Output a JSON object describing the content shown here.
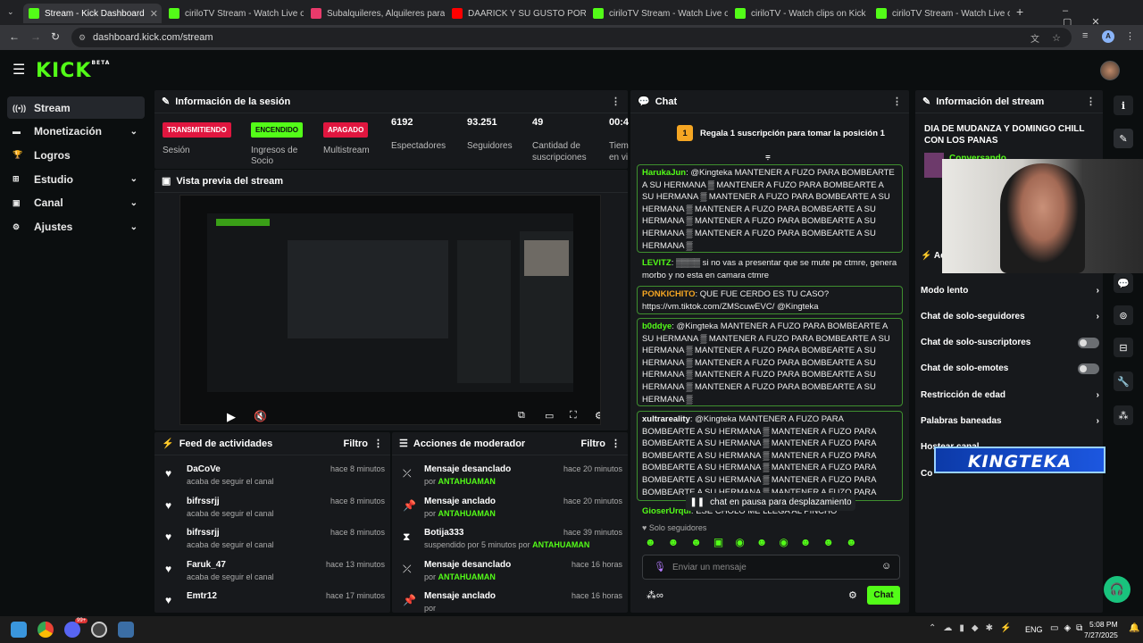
{
  "browser": {
    "tabs": [
      {
        "label": "Stream - Kick Dashboard",
        "color": "#53fc18",
        "active": true
      },
      {
        "label": "ciriloTV Stream - Watch Live on",
        "color": "#53fc18"
      },
      {
        "label": "Subalquileres, Alquileres para e",
        "color": "#e83a6b"
      },
      {
        "label": "DAARICK Y SU GUSTO POR LAS",
        "color": "#ff0000"
      },
      {
        "label": "ciriloTV Stream - Watch Live on",
        "color": "#53fc18"
      },
      {
        "label": "ciriloTV - Watch clips on Kick",
        "color": "#53fc18"
      },
      {
        "label": "ciriloTV Stream - Watch Live on",
        "color": "#53fc18"
      }
    ],
    "new_tab": "+",
    "url": "dashboard.kick.com/stream",
    "profile": "A"
  },
  "header": {
    "logo": "KICK",
    "logo_sup": "BETA"
  },
  "sidebar": {
    "items": [
      {
        "label": "Stream",
        "icon": "broadcast-icon",
        "glyph": "((•))",
        "chev": ""
      },
      {
        "label": "Monetización",
        "icon": "money-icon",
        "glyph": "▬",
        "chev": "⌄"
      },
      {
        "label": "Logros",
        "icon": "trophy-icon",
        "glyph": "🏆",
        "chev": ""
      },
      {
        "label": "Estudio",
        "icon": "studio-icon",
        "glyph": "⊞",
        "chev": "⌄"
      },
      {
        "label": "Canal",
        "icon": "channel-icon",
        "glyph": "▣",
        "chev": "⌄"
      },
      {
        "label": "Ajustes",
        "icon": "settings-icon",
        "glyph": "⚙",
        "chev": "⌄"
      }
    ]
  },
  "session": {
    "title": "Información de la sesión",
    "badges": [
      {
        "text": "TRANSMITIENDO",
        "label": "Sesión",
        "bg": "#e0163f",
        "fg": "#fff"
      },
      {
        "text": "ENCENDIDO",
        "label": "Ingresos de Socio",
        "bg": "#53fc18",
        "fg": "#0b0e0f"
      },
      {
        "text": "APAGADO",
        "label": "Multistream",
        "bg": "#e0163f",
        "fg": "#fff"
      }
    ],
    "stats": [
      {
        "value": "6192",
        "label": "Espectadores"
      },
      {
        "value": "93.251",
        "label": "Seguidores"
      },
      {
        "value": "49",
        "label": "Cantidad de suscripciones"
      },
      {
        "value": "00:4",
        "label": "Tiem en vi"
      }
    ]
  },
  "preview": {
    "title": "Vista previa del stream"
  },
  "feed": {
    "title": "Feed de actividades",
    "filter": "Filtro",
    "items": [
      {
        "name": "DaCoVe",
        "sub": "acaba de seguir el canal",
        "time": "hace 8 minutos"
      },
      {
        "name": "bifrssrjj",
        "sub": "acaba de seguir el canal",
        "time": "hace 8 minutos"
      },
      {
        "name": "bifrssrjj",
        "sub": "acaba de seguir el canal",
        "time": "hace 8 minutos"
      },
      {
        "name": "Faruk_47",
        "sub": "acaba de seguir el canal",
        "time": "hace 13 minutos"
      },
      {
        "name": "Emtr12",
        "sub": "",
        "time": "hace 17 minutos"
      }
    ]
  },
  "modactions": {
    "title": "Acciones de moderador",
    "filter": "Filtro",
    "items": [
      {
        "name": "Mensaje desanclado",
        "sub": "por ",
        "who": "ANTAHUAMAN",
        "time": "hace 20 minutos",
        "icon": "unpin-icon",
        "glyph": "⤫"
      },
      {
        "name": "Mensaje anclado",
        "sub": "por ",
        "who": "ANTAHUAMAN",
        "time": "hace 20 minutos",
        "icon": "pin-icon",
        "glyph": "📌"
      },
      {
        "name": "Botija333",
        "sub": "suspendido por 5 minutos por ",
        "who": "ANTAHUAMAN",
        "time": "hace 39 minutos",
        "icon": "timeout-icon",
        "glyph": "⧗"
      },
      {
        "name": "Mensaje desanclado",
        "sub": "por ",
        "who": "ANTAHUAMAN",
        "time": "hace 16 horas",
        "icon": "unpin-icon",
        "glyph": "⤫"
      },
      {
        "name": "Mensaje anclado",
        "sub": "por ",
        "who": "",
        "time": "hace 16 horas",
        "icon": "pin-icon",
        "glyph": "📌"
      }
    ]
  },
  "chat": {
    "title": "Chat",
    "sub_goal_rank": "1",
    "sub_goal": "Regala 1 suscripción para tomar la posición 1",
    "messages": [
      {
        "user": "HarukaJun",
        "color": "#53fc18",
        "text": "@Kingteka MANTENER A FUZO PARA BOMBEARTE A SU HERMANA ▒ MANTENER A FUZO PARA BOMBEARTE A SU HERMANA ▒ MANTENER A FUZO PARA BOMBEARTE A SU HERMANA ▒ MANTENER A FUZO PARA BOMBEARTE A SU HERMANA ▒ MANTENER A FUZO PARA BOMBEARTE A SU HERMANA ▒ MANTENER A FUZO PARA BOMBEARTE A SU HERMANA ▒"
      },
      {
        "user": "LEVITZ",
        "color": "#53fc18",
        "text": "▒▒▒▒ si no vas a presentar que se mute pe ctmre, genera morbo y no esta en camara ctmre"
      },
      {
        "user": "PONKICHITO",
        "color": "#f5a623",
        "text": "QUE FUE CERDO ES TU CASO? https://vm.tiktok.com/ZMScuwEVC/ @Kingteka"
      },
      {
        "user": "b0ddye",
        "color": "#53fc18",
        "text": "@Kingteka MANTENER A FUZO PARA BOMBEARTE A SU HERMANA ▒ MANTENER A FUZO PARA BOMBEARTE A SU HERMANA ▒ MANTENER A FUZO PARA BOMBEARTE A SU HERMANA ▒ MANTENER A FUZO PARA BOMBEARTE A SU HERMANA ▒ MANTENER A FUZO PARA BOMBEARTE A SU HERMANA ▒ MANTENER A FUZO PARA BOMBEARTE A SU HERMANA ▒"
      },
      {
        "user": "xultrareality",
        "color": "#fff",
        "text": "@Kingteka MANTENER A FUZO PARA BOMBEARTE A SU HERMANA ▒ MANTENER A FUZO PARA BOMBEARTE A SU HERMANA ▒ MANTENER A FUZO PARA BOMBEARTE A SU HERMANA ▒ MANTENER A FUZO PARA BOMBEARTE A SU HERMANA ▒ MANTENER A FUZO PARA BOMBEARTE A SU HERMANA ▒ MANTENER A FUZO PARA BOMBEARTE A SU HERMANA ▒ MANTENER A FUZO PARA BOMBEARTE A SU HERMANA ▒"
      },
      {
        "user": "GioserUrqui",
        "color": "#53fc18",
        "text": "ESE CHOLO ME LLEGA AL PINCHO"
      }
    ],
    "paused": "chat en pausa para desplazamiento",
    "mode": "Solo seguidores",
    "placeholder": "Enviar un mensaje",
    "send": "Chat"
  },
  "streaminfo": {
    "title": "Información del stream",
    "stream_title": "DIA DE MUDANZA Y DOMINGO CHILL CON LOS PANAS",
    "category": "Conversando",
    "settings_header": "Ac",
    "settings": [
      {
        "label": "Modo lento",
        "type": "arrow"
      },
      {
        "label": "Chat de solo-seguidores",
        "type": "arrow"
      },
      {
        "label": "Chat de solo-suscriptores",
        "type": "toggle"
      },
      {
        "label": "Chat de solo-emotes",
        "type": "toggle"
      },
      {
        "label": "Restricción de edad",
        "type": "arrow"
      },
      {
        "label": "Palabras baneadas",
        "type": "arrow"
      },
      {
        "label": "Hostear canal",
        "type": "none"
      },
      {
        "label": "Co",
        "type": "none"
      }
    ],
    "overlay_name": "KINGTEKA"
  },
  "taskbar": {
    "lang": "ENG",
    "time": "5:08 PM",
    "date": "7/27/2025",
    "badge": "99+"
  }
}
